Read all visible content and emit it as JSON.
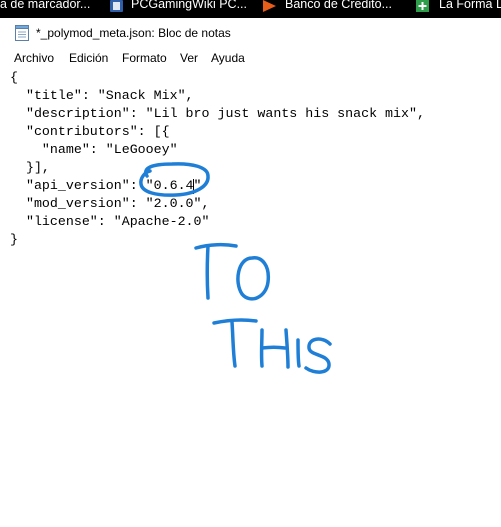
{
  "bookmarks_bar": {
    "items": [
      {
        "label": "a de marcador..."
      },
      {
        "label": "PCGamingWiki PC..."
      },
      {
        "label": "Banco de Credito..."
      },
      {
        "label": "La Forma L"
      }
    ]
  },
  "window": {
    "title": "*_polymod_meta.json: Bloc de notas"
  },
  "menu": {
    "items": [
      "Archivo",
      "Edición",
      "Formato",
      "Ver",
      "Ayuda"
    ]
  },
  "editor": {
    "lines": [
      "{",
      "  \"title\": \"Snack Mix\",",
      "  \"description\": \"Lil bro just wants his snack mix\",",
      "  \"contributors\": [{",
      "    \"name\": \"LeGooey\"",
      "  }],",
      "  \"api_version\": \"0.6.4\"",
      "  \"mod_version\": \"2.0.0\",",
      "  \"license\": \"Apache-2.0\"",
      "}"
    ]
  },
  "annotation": {
    "color": "#1f7fd6",
    "words": [
      "TO",
      "THIS"
    ]
  },
  "colors": {
    "bookmarks_bg": "#000000",
    "pcgamingwiki_icon": "#2f5fa8",
    "banco_icon": "#e85d1a",
    "laforma_icon": "#2e9e4a"
  }
}
